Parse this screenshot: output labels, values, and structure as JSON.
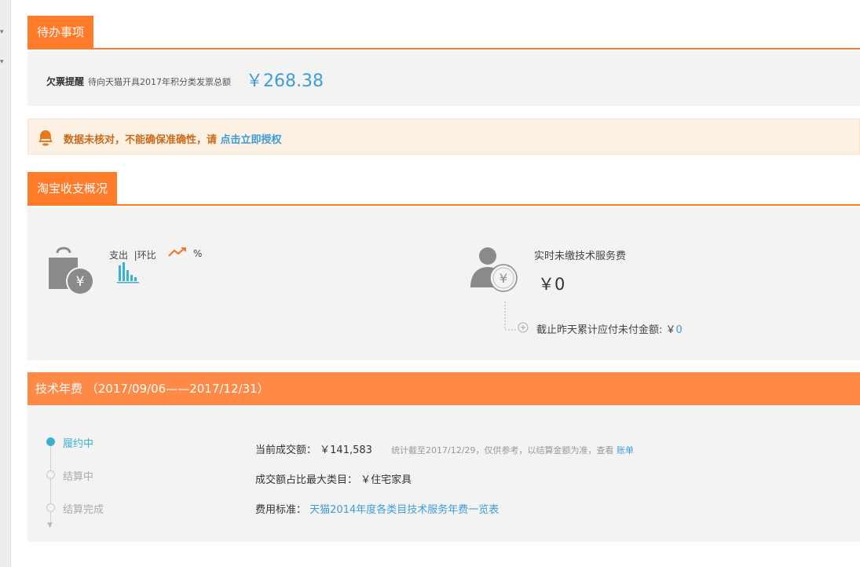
{
  "sidebar": {
    "chevrons": [
      "▾",
      "▾"
    ]
  },
  "todo": {
    "tab_label": "待办事项",
    "label": "欠票提醒",
    "desc": "待向天猫开具2017年积分类发票总额",
    "amount": "￥268.38"
  },
  "warning": {
    "text": "数据未核对，不能确保准确性，请 ",
    "link": "点击立即授权",
    "icon": "bell-icon"
  },
  "overview": {
    "tab_label": "淘宝收支概况",
    "expense_label": "支出",
    "mom_label": "|环比",
    "percent_sign": "%",
    "fee_title": "实时未缴技术服务费",
    "fee_amount": "￥0",
    "accum_label": "截止昨天累计应付未付金额: ￥",
    "accum_value": "0",
    "colors": {
      "accent": "#ff7a29",
      "link": "#3d9ddb",
      "icon_gray": "#8a8a8a"
    }
  },
  "tech_fee": {
    "title": "技术年费 （2017/09/06——2017/12/31）",
    "timeline": [
      {
        "label": "履约中",
        "state": "active"
      },
      {
        "label": "结算中",
        "state": "idle"
      },
      {
        "label": "结算完成",
        "state": "idle"
      }
    ],
    "current_label": "当前成交额：",
    "current_value": "￥141,583",
    "current_note": "统计截至2017/12/29，仅供参考，以结算金额为准，查看 ",
    "current_link": "账单",
    "category_label": "成交额占比最大类目：",
    "category_value": "￥住宅家具",
    "standard_label": "费用标准：",
    "standard_link": "天猫2014年度各类目技术服务年费一览表",
    "colors": {
      "header": "#ff8a48",
      "active": "#3ab1cf"
    }
  }
}
